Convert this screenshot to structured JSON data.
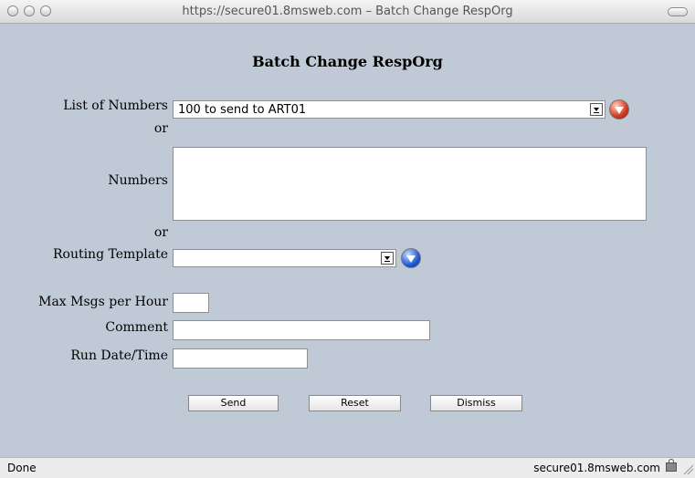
{
  "window": {
    "title": "https://secure01.8msweb.com – Batch Change RespOrg"
  },
  "page": {
    "heading": "Batch Change RespOrg"
  },
  "form": {
    "list_of_numbers_label": "List of Numbers",
    "list_of_numbers_value": "100 to send to ART01",
    "or_label_1": "or",
    "numbers_label": "Numbers",
    "numbers_value": "",
    "or_label_2": "or",
    "routing_template_label": "Routing Template",
    "routing_template_value": "",
    "max_msgs_label": "Max Msgs per Hour",
    "max_msgs_value": "",
    "comment_label": "Comment",
    "comment_value": "",
    "run_datetime_label": "Run Date/Time",
    "run_datetime_value": ""
  },
  "buttons": {
    "send": "Send",
    "reset": "Reset",
    "dismiss": "Dismiss"
  },
  "statusbar": {
    "left": "Done",
    "right": "secure01.8msweb.com"
  },
  "icons": {
    "list_action": "red-chevron-down-icon",
    "template_action": "blue-chevron-down-icon",
    "security": "lock-icon"
  },
  "colors": {
    "content_bg": "#bfcad6",
    "list_action_button": "#d03a20",
    "template_action_button": "#1f5bd6"
  }
}
